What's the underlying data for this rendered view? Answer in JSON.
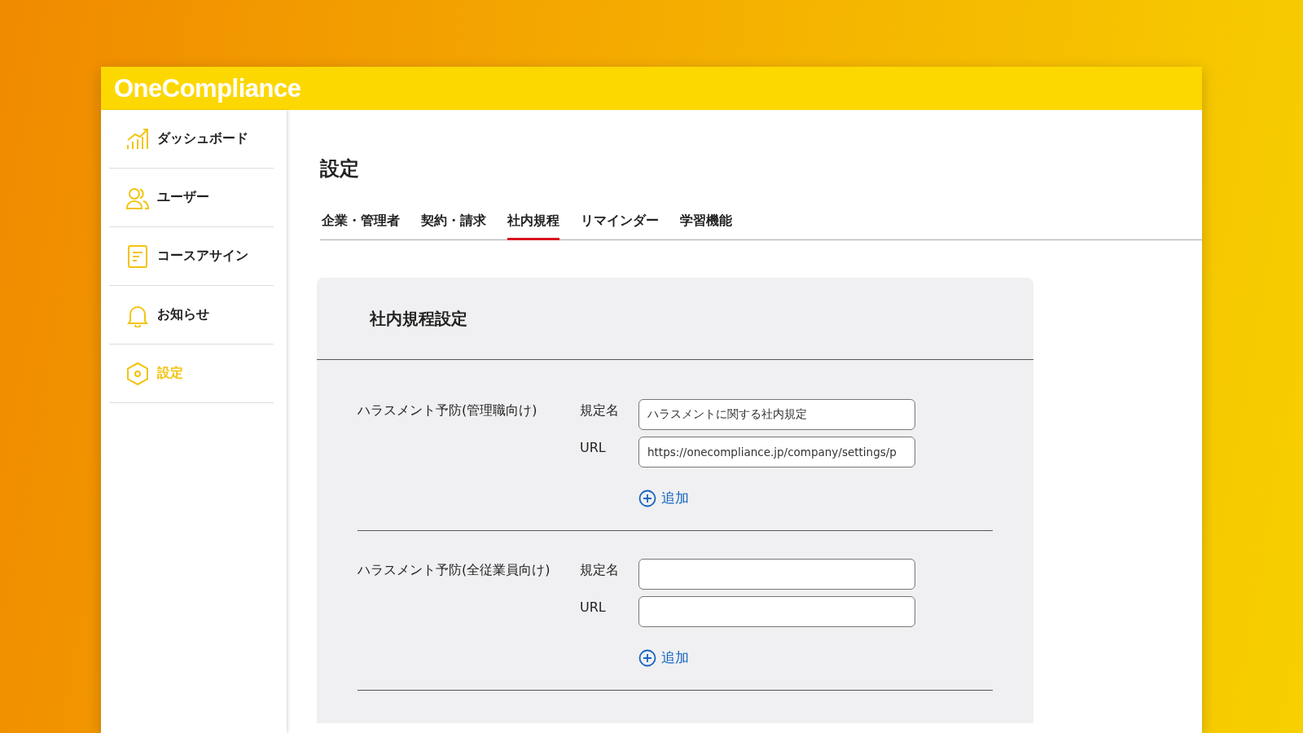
{
  "app": {
    "logo": "OneCompliance"
  },
  "sidebar": {
    "items": [
      {
        "label": "ダッシュボード",
        "kind": "chart",
        "selected": false
      },
      {
        "label": "ユーザー",
        "kind": "users",
        "selected": false
      },
      {
        "label": "コースアサイン",
        "kind": "document",
        "selected": false
      },
      {
        "label": "お知らせ",
        "kind": "bell",
        "selected": false
      },
      {
        "label": "設定",
        "kind": "settings",
        "selected": true
      }
    ]
  },
  "page": {
    "title": "設定"
  },
  "tabs": [
    {
      "label": "企業・管理者",
      "selected": false
    },
    {
      "label": "契約・請求",
      "selected": false
    },
    {
      "label": "社内規程",
      "selected": true
    },
    {
      "label": "リマインダー",
      "selected": false
    },
    {
      "label": "学習機能",
      "selected": false
    }
  ],
  "card": {
    "title": "社内規程設定",
    "sections": [
      {
        "name": "ハラスメント予防(管理職向け)",
        "fields": [
          {
            "label": "規定名",
            "value": "ハラスメントに関する社内規定"
          },
          {
            "label": "URL",
            "value": "https://onecompliance.jp/company/settings/p"
          }
        ],
        "add_label": "追加"
      },
      {
        "name": "ハラスメント予防(全従業員向け)",
        "fields": [
          {
            "label": "規定名"
          },
          {
            "label": "URL"
          }
        ],
        "add_label": "追加"
      }
    ]
  }
}
